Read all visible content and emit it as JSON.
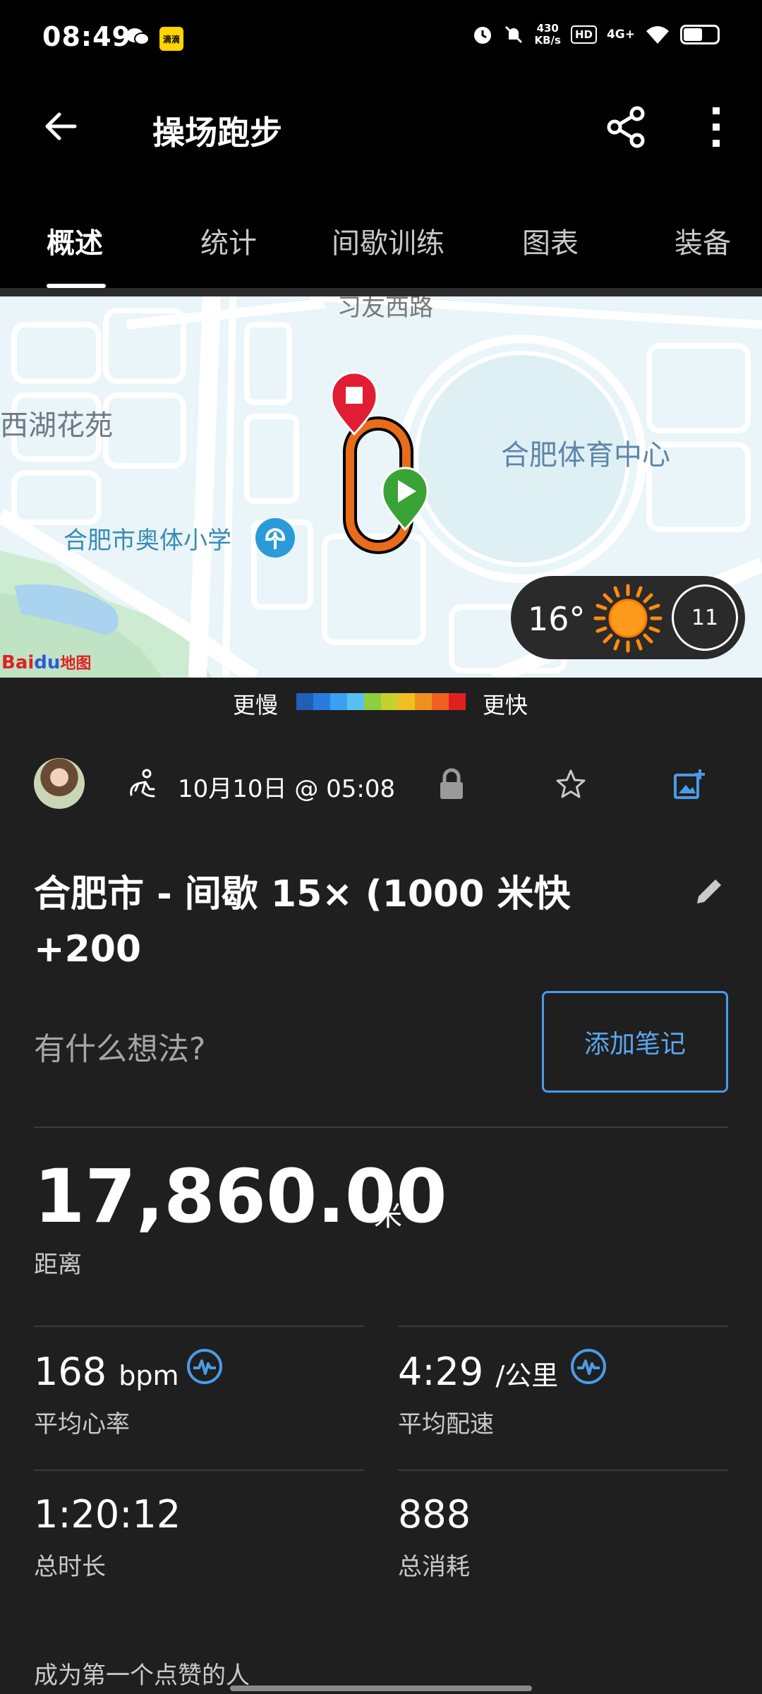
{
  "status_bar": {
    "time": "08:49",
    "net_speed_value": "430",
    "net_speed_unit": "KB/s",
    "hd": "HD",
    "network": "4G+",
    "app_badge": "滴滴"
  },
  "header": {
    "title": "操场跑步"
  },
  "tabs": [
    {
      "label": "概述",
      "active": true
    },
    {
      "label": "统计"
    },
    {
      "label": "间歇训练"
    },
    {
      "label": "图表"
    },
    {
      "label": "装备"
    }
  ],
  "map": {
    "labels": {
      "road_top": "习友西路",
      "area_left": "西湖花苑",
      "stadium": "合肥体育中心",
      "school": "合肥市奥体小学",
      "map_provider": "Bai",
      "map_provider_du": "du",
      "map_provider_suffix": "地图"
    },
    "weather": {
      "temperature": "16°",
      "uv_index": "11"
    }
  },
  "pace_legend": {
    "slower": "更慢",
    "faster": "更快",
    "colors": [
      "#1f5fb8",
      "#2a7be0",
      "#3aa0f0",
      "#58c0f0",
      "#8cd040",
      "#c8d030",
      "#f0c020",
      "#f09020",
      "#f06020",
      "#e02020"
    ]
  },
  "activity": {
    "date": "10月10日 @ 05:08",
    "title": "合肥市 - 间歇 15× (1000 米快 +200",
    "notes_placeholder": "有什么想法?",
    "add_note_label": "添加笔记"
  },
  "stats": {
    "distance_value": "17,860.00",
    "distance_unit": "米",
    "distance_label": "距离",
    "avg_hr_value": "168",
    "avg_hr_unit": "bpm",
    "avg_hr_label": "平均心率",
    "avg_pace_value": "4:29",
    "avg_pace_unit": "/公里",
    "avg_pace_label": "平均配速",
    "duration_value": "1:20:12",
    "duration_label": "总时长",
    "calories_value": "888",
    "calories_label": "总消耗"
  },
  "social": {
    "likes_text": "成为第一个点赞的人"
  },
  "colors": {
    "accent": "#4a9be8",
    "background": "#1f1f1f",
    "header": "#000000"
  }
}
